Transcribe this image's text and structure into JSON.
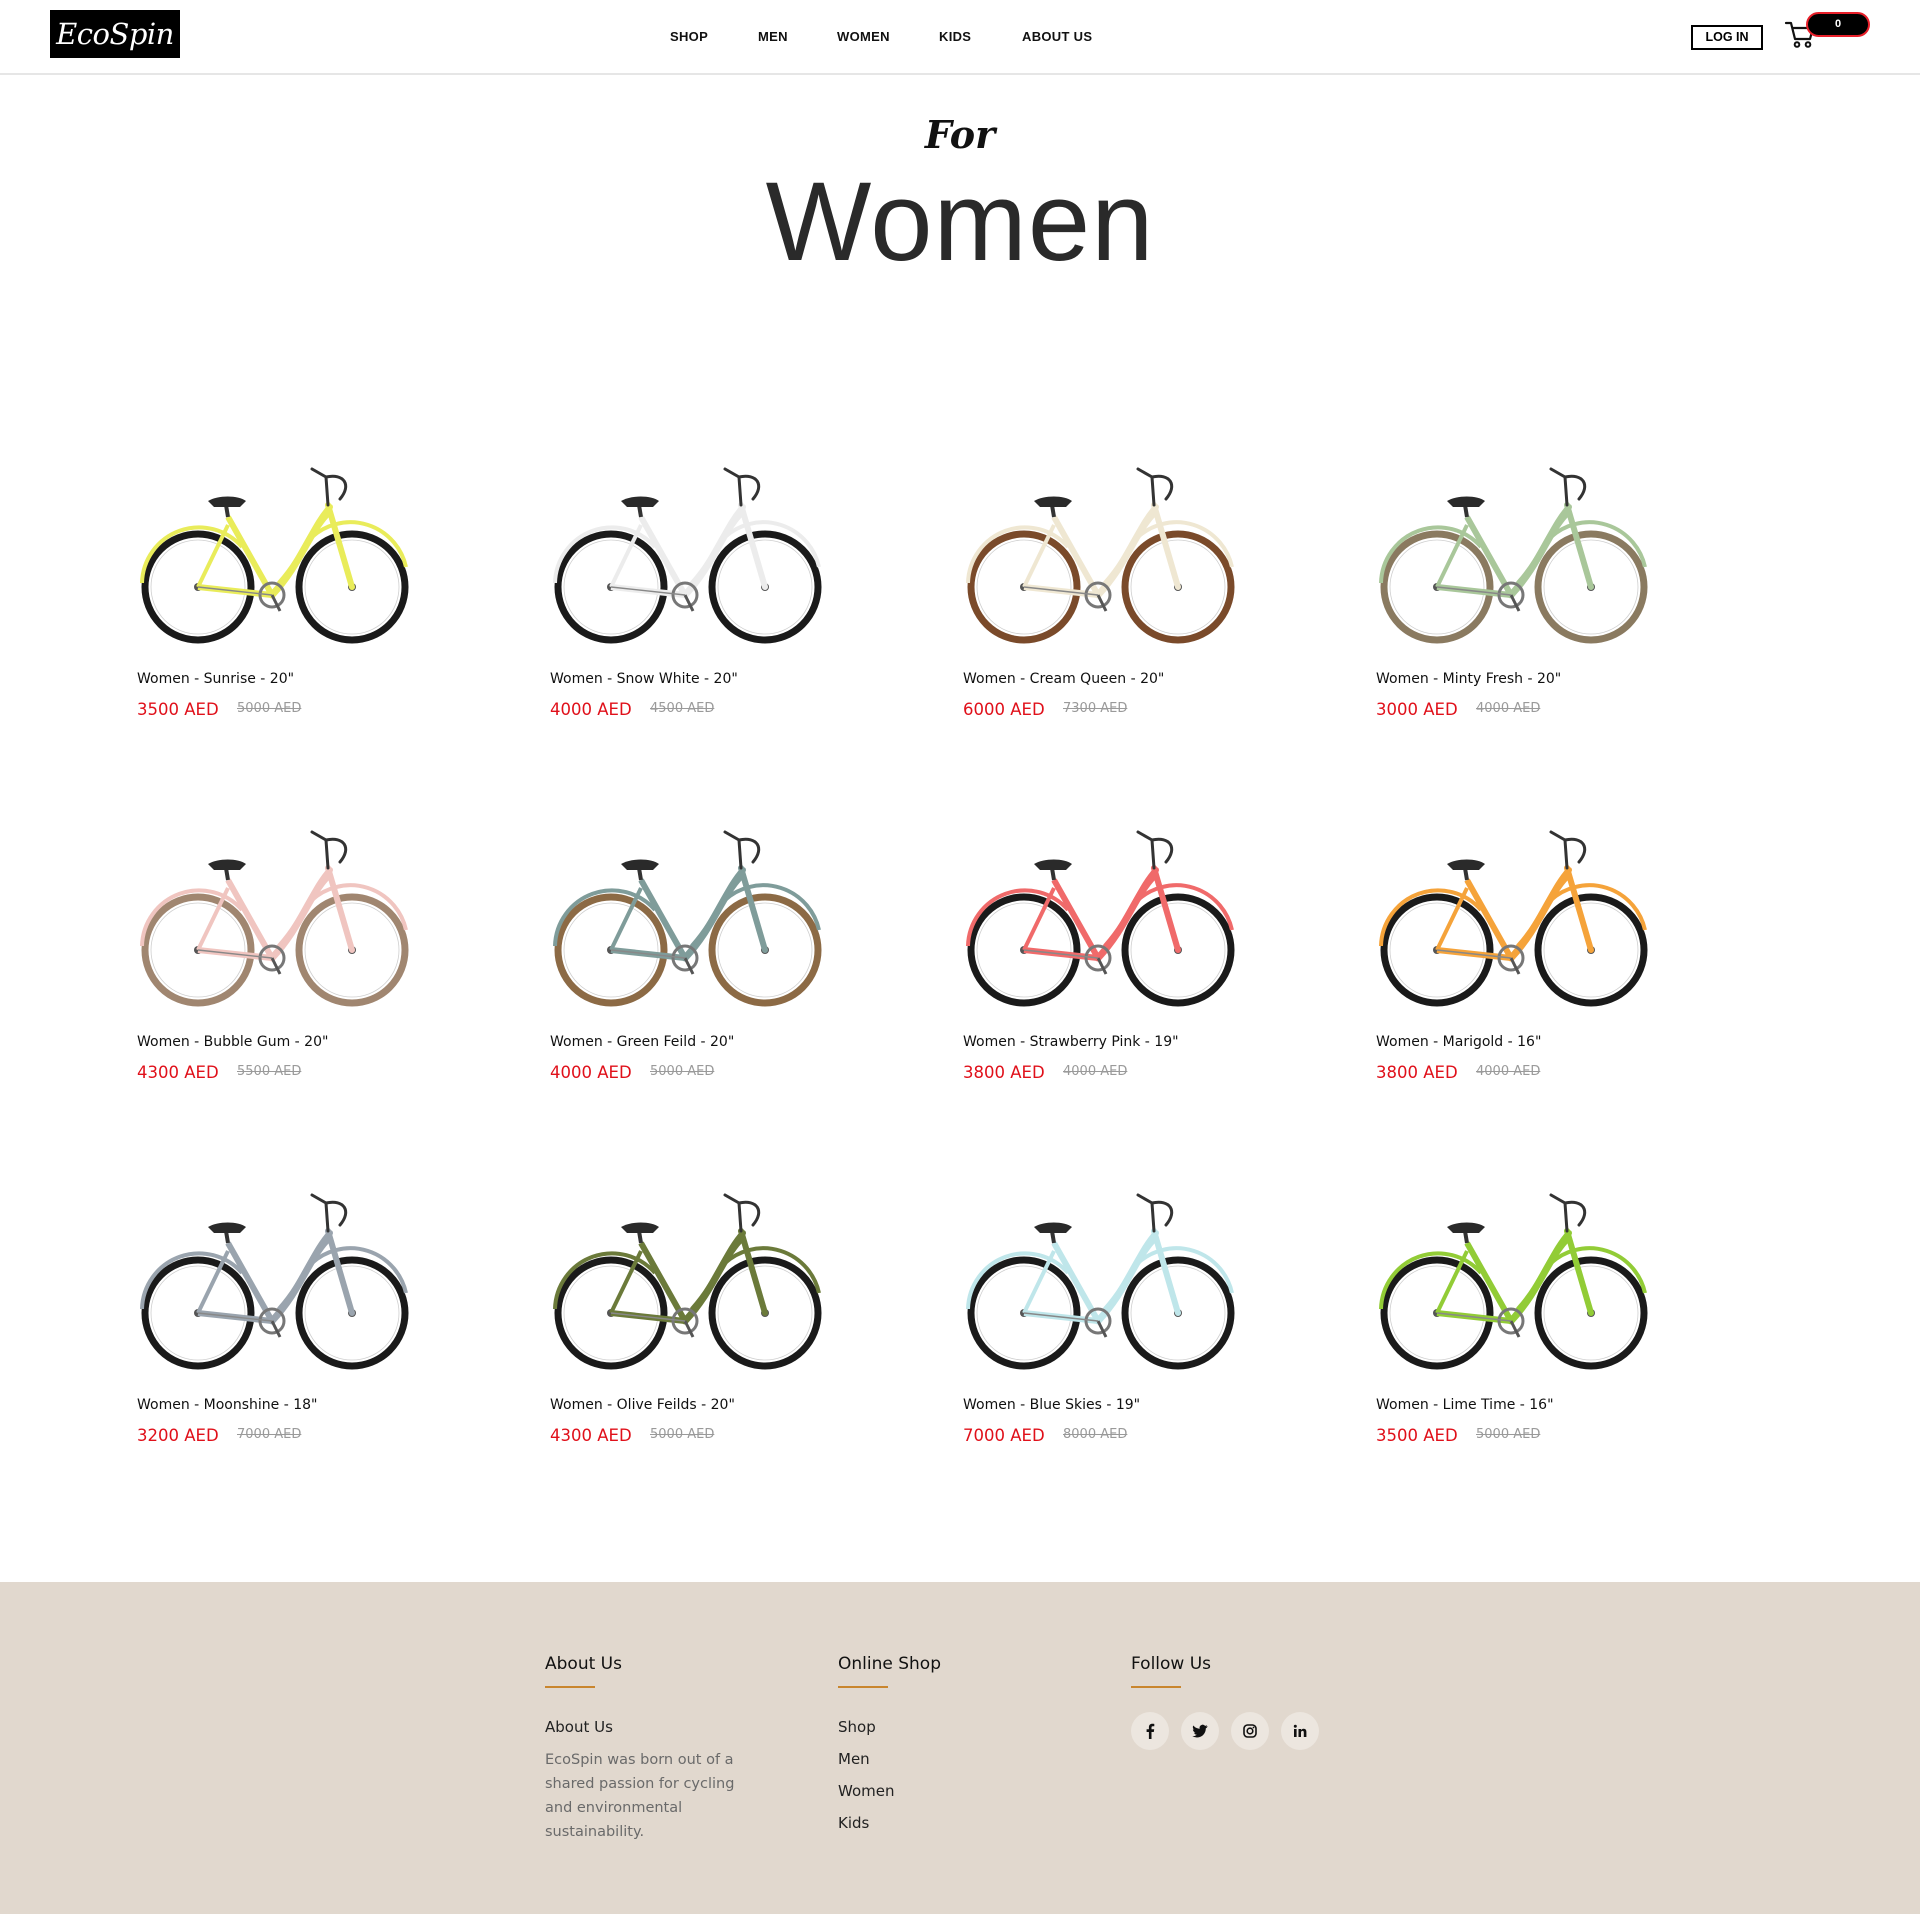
{
  "header": {
    "logo": "EcoSpin",
    "nav": [
      "SHOP",
      "MEN",
      "WOMEN",
      "KIDS",
      "ABOUT US"
    ],
    "login_label": "LOG IN",
    "cart_count": "0",
    "cart_icon": "shopping-cart-icon"
  },
  "hero": {
    "for_text": "For",
    "title": "Women"
  },
  "products": [
    {
      "name": "Women - Sunrise - 20\"",
      "price": "3500 AED",
      "old_price": "5000 AED",
      "frame_color": "#e9ec5a",
      "tire_color": "#1a1a1a"
    },
    {
      "name": "Women - Snow White - 20\"",
      "price": "4000 AED",
      "old_price": "4500 AED",
      "frame_color": "#ececec",
      "tire_color": "#1a1a1a"
    },
    {
      "name": "Women - Cream Queen - 20\"",
      "price": "6000 AED",
      "old_price": "7300 AED",
      "frame_color": "#efe7d2",
      "tire_color": "#7a4a2a"
    },
    {
      "name": "Women - Minty Fresh - 20\"",
      "price": "3000 AED",
      "old_price": "4000 AED",
      "frame_color": "#a9c79a",
      "tire_color": "#8a7a60"
    },
    {
      "name": "Women - Bubble Gum - 20\"",
      "price": "4300 AED",
      "old_price": "5500 AED",
      "frame_color": "#f0c5c0",
      "tire_color": "#a08670"
    },
    {
      "name": "Women - Green Feild - 20\"",
      "price": "4000 AED",
      "old_price": "5000 AED",
      "frame_color": "#7f9c9a",
      "tire_color": "#8c6a45"
    },
    {
      "name": "Women - Strawberry Pink - 19\"",
      "price": "3800 AED",
      "old_price": "4000 AED",
      "frame_color": "#f06a6a",
      "tire_color": "#1a1a1a"
    },
    {
      "name": "Women - Marigold - 16\"",
      "price": "3800 AED",
      "old_price": "4000 AED",
      "frame_color": "#f5a33a",
      "tire_color": "#1a1a1a"
    },
    {
      "name": "Women - Moonshine - 18\"",
      "price": "3200 AED",
      "old_price": "7000 AED",
      "frame_color": "#9aa4ae",
      "tire_color": "#1a1a1a"
    },
    {
      "name": "Women - Olive Feilds - 20\"",
      "price": "4300 AED",
      "old_price": "5000 AED",
      "frame_color": "#6b7a3a",
      "tire_color": "#1a1a1a"
    },
    {
      "name": "Women - Blue Skies - 19\"",
      "price": "7000 AED",
      "old_price": "8000 AED",
      "frame_color": "#bfe6ea",
      "tire_color": "#1a1a1a"
    },
    {
      "name": "Women - Lime Time - 16\"",
      "price": "3500 AED",
      "old_price": "5000 AED",
      "frame_color": "#92cc36",
      "tire_color": "#1a1a1a"
    }
  ],
  "footer": {
    "about": {
      "heading": "About Us",
      "link": "About Us",
      "text": "EcoSpin was born out of a shared passion for cycling and environmental sustainability."
    },
    "shop": {
      "heading": "Online Shop",
      "links": [
        "Shop",
        "Men",
        "Women",
        "Kids"
      ]
    },
    "follow": {
      "heading": "Follow Us",
      "socials": [
        "facebook-icon",
        "twitter-icon",
        "instagram-icon",
        "linkedin-icon"
      ]
    },
    "accent_color": "#c9862e",
    "background_color": "#e1d8ce"
  },
  "colors": {
    "sale_price": "#e0101a",
    "old_price": "#9a9a9a",
    "cart_badge_border": "#e8202a"
  }
}
